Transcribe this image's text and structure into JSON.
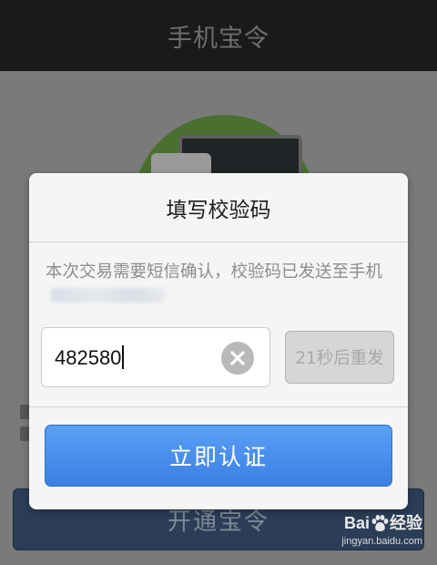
{
  "app": {
    "title": "手机宝令",
    "primary_button_label": "开通宝令"
  },
  "dialog": {
    "title": "填写校验码",
    "message": "本次交易需要短信确认，校验码已发送至手机",
    "code_input": {
      "value": "482580"
    },
    "resend_label": "21秒后重发",
    "verify_label": "立即认证"
  },
  "watermark": {
    "brand_prefix": "Bai",
    "brand_suffix": "经验",
    "url": "jingyan.baidu.com"
  },
  "colors": {
    "accent": "#3b7fe2",
    "topbar": "#1a1a1c",
    "disabled_button": "#d6d6d6"
  },
  "icons": [
    "clear-icon",
    "baidu-paw-icon"
  ]
}
